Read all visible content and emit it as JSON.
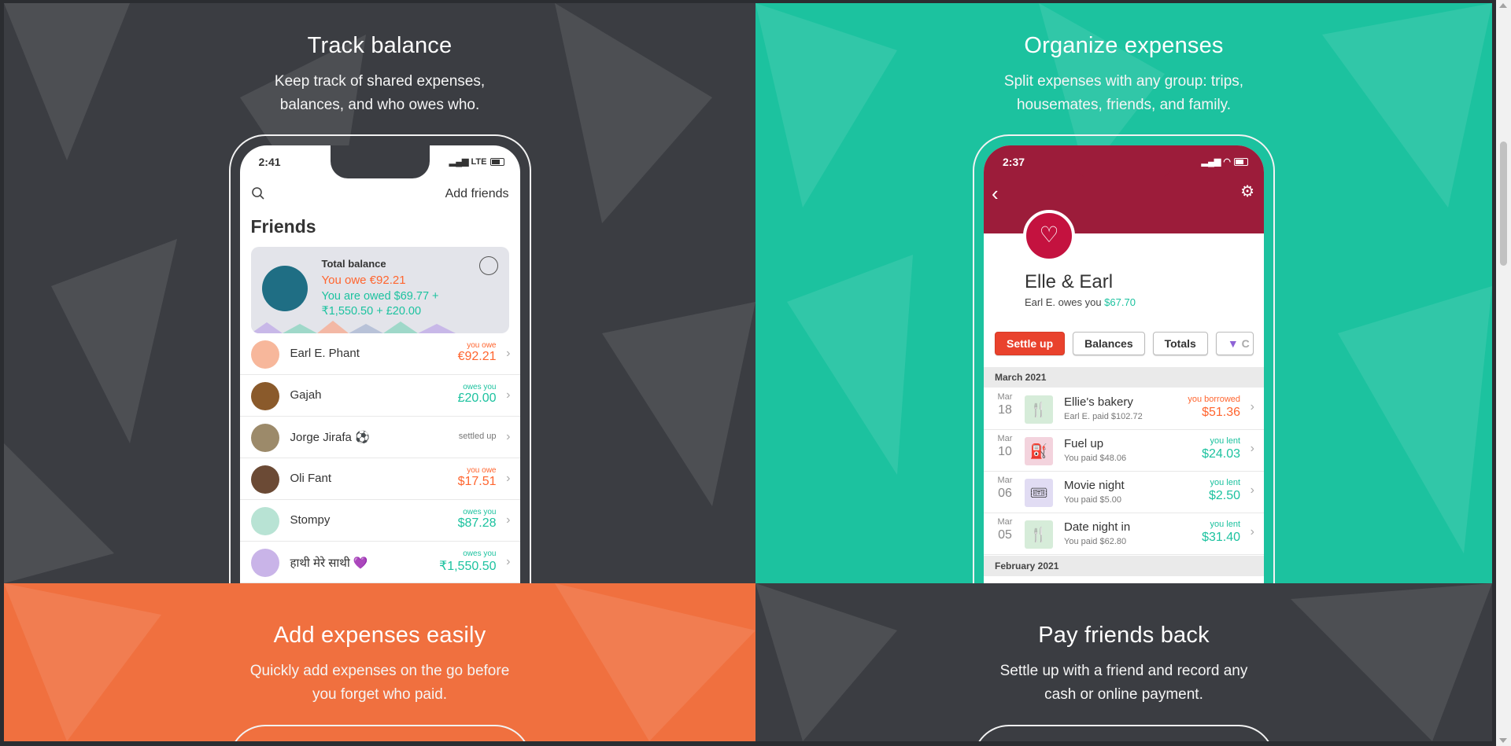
{
  "panels": {
    "track": {
      "title": "Track balance",
      "subtitle": "Keep track of shared expenses, balances, and who owes who."
    },
    "organize": {
      "title": "Organize expenses",
      "subtitle": "Split expenses with any group: trips, housemates, friends, and family."
    },
    "add": {
      "title": "Add expenses easily",
      "subtitle": "Quickly add expenses on the go before you forget who paid."
    },
    "pay": {
      "title": "Pay friends back",
      "subtitle": "Settle up with a friend and record any cash or online payment."
    }
  },
  "left_phone": {
    "time": "2:41",
    "network": "LTE",
    "add_friends": "Add friends",
    "heading": "Friends",
    "balance": {
      "label": "Total balance",
      "you_owe": "You owe €92.21",
      "you_are_owed": "You are owed $69.77 + ₹1,550.50 + £20.00"
    },
    "friends": [
      {
        "name": "Earl E. Phant",
        "status": "you owe",
        "amount": "€92.21",
        "kind": "neg",
        "color": "#f7b79b"
      },
      {
        "name": "Gajah",
        "status": "owes you",
        "amount": "£20.00",
        "kind": "pos",
        "color": "#8a5a2b"
      },
      {
        "name": "Jorge Jirafa ⚽",
        "status": "settled up",
        "amount": "",
        "kind": "settled",
        "color": "#9c8a6a"
      },
      {
        "name": "Oli Fant",
        "status": "you owe",
        "amount": "$17.51",
        "kind": "neg",
        "color": "#6b4a35"
      },
      {
        "name": "Stompy",
        "status": "owes you",
        "amount": "$87.28",
        "kind": "pos",
        "color": "#b8e3d4"
      },
      {
        "name": "हाथी मेरे साथी 💜",
        "status": "owes you",
        "amount": "₹1,550.50",
        "kind": "pos",
        "color": "#c9b4e8"
      }
    ]
  },
  "right_phone": {
    "time": "2:37",
    "group_name": "Elle & Earl",
    "group_sub_prefix": "Earl E. owes you ",
    "group_sub_amount": "$67.70",
    "tabs": [
      "Settle up",
      "Balances",
      "Totals",
      "C"
    ],
    "month1": "March 2021",
    "month2": "February 2021",
    "expenses": [
      {
        "mon": "Mar",
        "day": "18",
        "title": "Ellie's bakery",
        "paid": "Earl E. paid $102.72",
        "status": "you borrowed",
        "amount": "$51.36",
        "kind": "neg",
        "icon": "🍴",
        "icon_bg": "#d6ecd9"
      },
      {
        "mon": "Mar",
        "day": "10",
        "title": "Fuel up",
        "paid": "You paid $48.06",
        "status": "you lent",
        "amount": "$24.03",
        "kind": "pos",
        "icon": "⛽",
        "icon_bg": "#f3d3dd"
      },
      {
        "mon": "Mar",
        "day": "06",
        "title": "Movie night",
        "paid": "You paid $5.00",
        "status": "you lent",
        "amount": "$2.50",
        "kind": "pos",
        "icon": "🎟",
        "icon_bg": "#e1dcf3"
      },
      {
        "mon": "Mar",
        "day": "05",
        "title": "Date night in",
        "paid": "You paid $62.80",
        "status": "you lent",
        "amount": "$31.40",
        "kind": "pos",
        "icon": "🍴",
        "icon_bg": "#d6ecd9"
      }
    ]
  },
  "colors": {
    "dark": "#3b3d42",
    "teal": "#1cc29f",
    "orange": "#f0703f",
    "owe": "#ff652f",
    "owed": "#1cc29f",
    "group": "#9c1c3a"
  }
}
